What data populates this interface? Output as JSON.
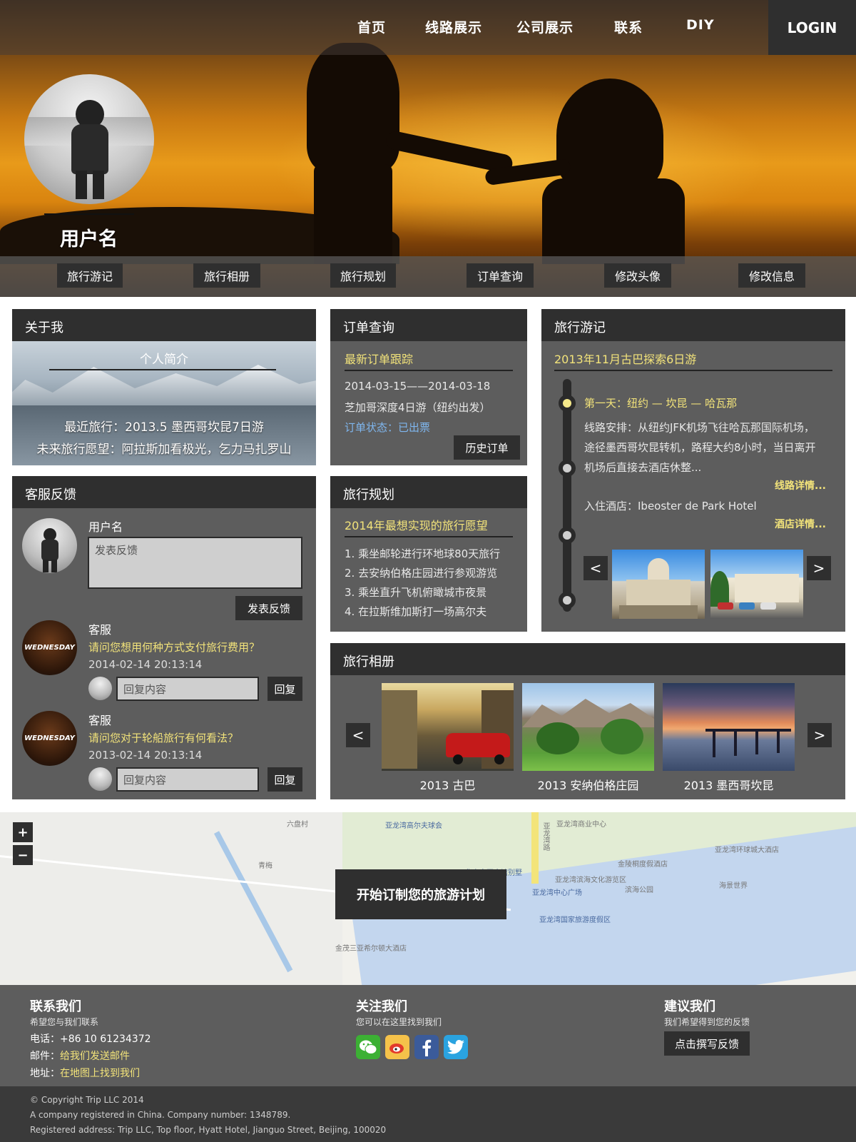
{
  "nav": {
    "items": [
      "首页",
      "线路展示",
      "公司展示",
      "联系",
      "DIY"
    ],
    "login": "LOGIN"
  },
  "profile": {
    "username": "用户名"
  },
  "subnav": [
    "旅行游记",
    "旅行相册",
    "旅行规划",
    "订单查询",
    "修改头像",
    "修改信息"
  ],
  "about": {
    "title": "关于我",
    "intro_heading": "个人简介",
    "recent": "最近旅行：2013.5 墨西哥坎昆7日游",
    "wish": "未来旅行愿望：阿拉斯加看极光，乞力马扎罗山"
  },
  "order": {
    "title": "订单查询",
    "subheading": "最新订单跟踪",
    "dates": "2014-03-15——2014-03-18",
    "trip": "芝加哥深度4日游（纽约出发）",
    "status": "订单状态：已出票",
    "history_button": "历史订单"
  },
  "journal": {
    "title": "旅行游记",
    "subheading": "2013年11月古巴探索6日游",
    "day": "第一天：纽约 — 坎昆 — 哈瓦那",
    "route_lines": [
      "线路安排：从纽约JFK机场飞往哈瓦那国际机场，",
      "途径墨西哥坎昆转机，路程大约8小时，当日离开",
      "机场后直接去酒店休整..."
    ],
    "route_link": "线路详情...",
    "hotel": "入住酒店：Ibeoster de Park Hotel",
    "hotel_link": "酒店详情...",
    "prev": "<",
    "next": ">"
  },
  "feedback": {
    "title": "客服反馈",
    "username": "用户名",
    "placeholder": "发表反馈",
    "submit": "发表反馈",
    "threads": [
      {
        "author": "客服",
        "question": "请问您想用何种方式支付旅行费用？",
        "time": "2014-02-14  20:13:14",
        "reply_placeholder": "回复内容",
        "reply_button": "回复",
        "avatar_text": "WEDNESDAY"
      },
      {
        "author": "客服",
        "question": "请问您对于轮船旅行有何看法？",
        "time": "2013-02-14  20:13:14",
        "reply_placeholder": "回复内容",
        "reply_button": "回复",
        "avatar_text": "WEDNESDAY"
      }
    ]
  },
  "plan": {
    "title": "旅行规划",
    "subheading": "2014年最想实现的旅行愿望",
    "items": [
      "1. 乘坐邮轮进行环地球80天旅行",
      "2. 去安纳伯格庄园进行参观游览",
      "3. 乘坐直升飞机俯瞰城市夜景",
      "4. 在拉斯维加斯打一场高尔夫"
    ]
  },
  "album": {
    "title": "旅行相册",
    "photos": [
      "2013 古巴",
      "2013 安纳伯格庄园",
      "2013 墨西哥坎昆"
    ],
    "prev": "<",
    "next": ">"
  },
  "map": {
    "cta": "开始订制您的旅游计划",
    "zoom_in": "+",
    "zoom_out": "−",
    "labels": [
      "亚龙湾高尔夫球会",
      "华宇皇冠会馆别墅",
      "亚龙湾中心广场",
      "亚龙湾国家旅游度假区",
      "青梅",
      "六盘村",
      "海景世界",
      "亚龙湾环球城大酒店",
      "金茂三亚希尔顿大酒店",
      "金陵桐度假酒店",
      "滨海公园",
      "亚龙湾滨海文化游览区",
      "亚龙湾路",
      "亚龙湾商业中心"
    ]
  },
  "footer": {
    "contact": {
      "title": "联系我们",
      "sub": "希望您与我们联系",
      "phone_label": "电话：",
      "phone": "+86 10 61234372",
      "mail_label": "邮件：",
      "mail": "给我们发送邮件",
      "addr_label": "地址：",
      "addr": "在地图上找到我们"
    },
    "follow": {
      "title": "关注我们",
      "sub": "您可以在这里找到我们",
      "icons": [
        "wechat-icon",
        "weibo-icon",
        "facebook-icon",
        "twitter-icon"
      ]
    },
    "suggest": {
      "title": "建议我们",
      "sub": "我们希望得到您的反馈",
      "button": "点击撰写反馈"
    },
    "copyright": [
      "© Copyright Trip LLC 2014",
      "A company registered in China. Company number: 1348789.",
      "Registered address: Trip LLC, Top floor, Hyatt Hotel, Jianguo Street, Beijing, 100020"
    ]
  }
}
